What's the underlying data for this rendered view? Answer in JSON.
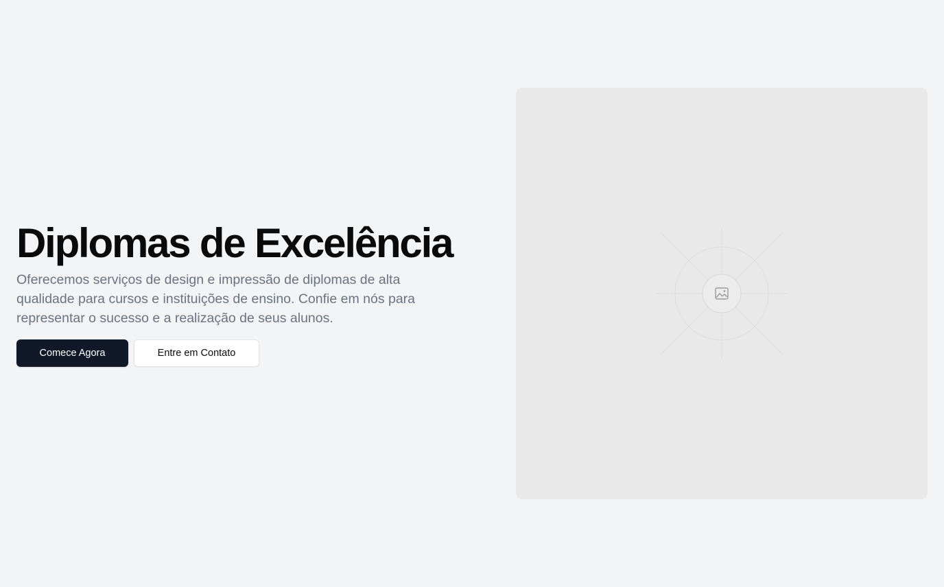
{
  "hero": {
    "title": "Diplomas de Excelência",
    "description": "Oferecemos serviços de design e impressão de diplomas de alta qualidade para cursos e instituições de ensino. Confie em nós para representar o sucesso e a realização de seus alunos.",
    "primary_button": "Comece Agora",
    "secondary_button": "Entre em Contato"
  },
  "media": {
    "icon": "image-placeholder-icon"
  },
  "colors": {
    "background": "#f2f4f6",
    "title": "#0a0a0a",
    "description": "#6b7280",
    "primary_button_bg": "#111827",
    "placeholder_bg": "#e9e9e9"
  }
}
